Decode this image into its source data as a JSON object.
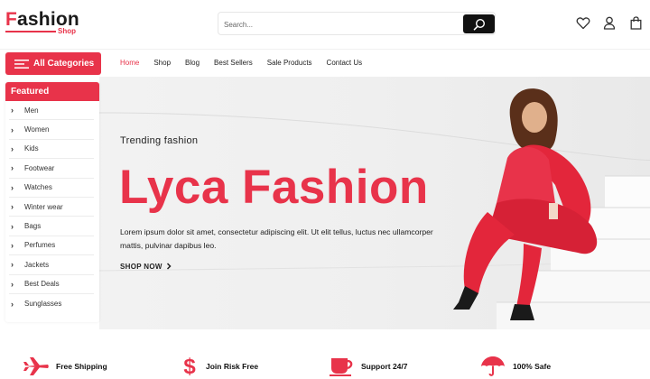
{
  "brand": {
    "logo_first": "F",
    "logo_rest": "ashion",
    "logo_sub": "Shop"
  },
  "search": {
    "placeholder": "Search..."
  },
  "header_icons": [
    "heart-icon",
    "user-icon",
    "shopping-bag-icon"
  ],
  "nav": {
    "all_categories": "All Categories",
    "links": [
      "Home",
      "Shop",
      "Blog",
      "Best Sellers",
      "Sale Products",
      "Contact Us"
    ],
    "active": "Home"
  },
  "sidebar": {
    "title": "Featured",
    "items": [
      "Men",
      "Women",
      "Kids",
      "Footwear",
      "Watches",
      "Winter wear",
      "Bags",
      "Perfumes",
      "Jackets",
      "Best Deals",
      "Sunglasses"
    ]
  },
  "hero": {
    "kicker": "Trending fashion",
    "title": "Lyca Fashion",
    "description": "Lorem ipsum dolor sit amet, consectetur adipiscing elit. Ut elit tellus, luctus nec ullamcorper mattis, pulvinar dapibus leo.",
    "cta": "SHOP NOW",
    "cta_icon": "chevron-right-icon"
  },
  "features": [
    {
      "label": "Free Shipping",
      "icon": "airplane-icon"
    },
    {
      "label": "Join Risk Free",
      "icon": "dollar-icon"
    },
    {
      "label": "Support 24/7",
      "icon": "coffee-cup-icon"
    },
    {
      "label": "100% Safe",
      "icon": "umbrella-icon"
    }
  ],
  "colors": {
    "accent": "#e8334a",
    "dark": "#111111",
    "hero_bg": "#efefef"
  }
}
